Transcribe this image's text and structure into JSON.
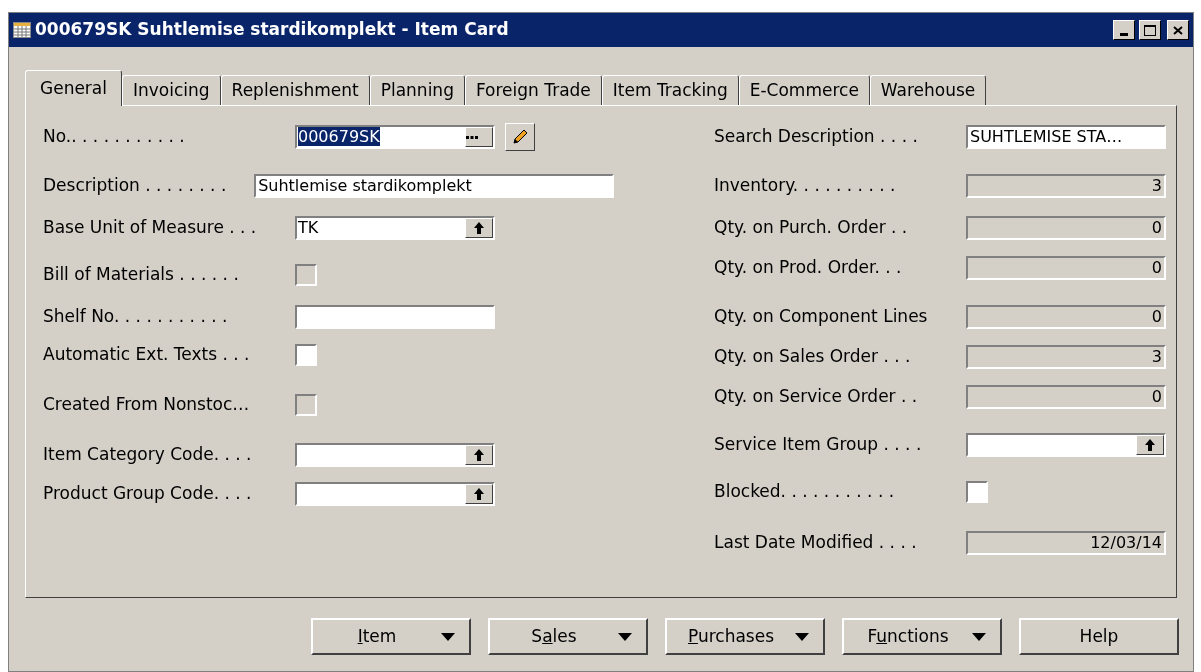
{
  "window": {
    "title": "000679SK Suhtlemise stardikomplekt - Item Card"
  },
  "tabs": [
    {
      "label": "General",
      "selected": true
    },
    {
      "label": "Invoicing",
      "selected": false
    },
    {
      "label": "Replenishment",
      "selected": false
    },
    {
      "label": "Planning",
      "selected": false
    },
    {
      "label": "Foreign Trade",
      "selected": false
    },
    {
      "label": "Item Tracking",
      "selected": false
    },
    {
      "label": "E-Commerce",
      "selected": false
    },
    {
      "label": "Warehouse",
      "selected": false
    }
  ],
  "left_fields": [
    {
      "kind": "code",
      "label": "No.. . . . . . . . . . .",
      "value": "000679SK"
    },
    {
      "kind": "text",
      "label": "Description . . . . . . . .",
      "value": "Suhtlemise stardikomplekt"
    },
    {
      "kind": "lookup",
      "label": "Base Unit of Measure . . .",
      "value": "TK"
    },
    {
      "kind": "checkbox",
      "label": "Bill of Materials . . . . . .",
      "checked": false,
      "disabled": true
    },
    {
      "kind": "input",
      "label": "Shelf No. . . . . . . . . . ."
    },
    {
      "kind": "checkbox",
      "label": "Automatic Ext. Texts . . .",
      "checked": false,
      "disabled": false
    },
    {
      "kind": "checkbox",
      "label": "Created From Nonstoc…",
      "checked": false,
      "disabled": true
    },
    {
      "kind": "lookup",
      "label": "Item Category Code. . . ."
    },
    {
      "kind": "lookup",
      "label": "Product Group Code. . . ."
    }
  ],
  "right_fields": [
    {
      "kind": "input",
      "label": "Search Description . . . .",
      "value": "SUHTLEMISE STA…"
    },
    {
      "kind": "readonly",
      "label": "Inventory. . . . . . . . . .",
      "value": "3"
    },
    {
      "kind": "readonly",
      "label": "Qty. on Purch. Order . .",
      "value": "0"
    },
    {
      "kind": "readonly",
      "label": "Qty. on Prod. Order. . .",
      "value": "0"
    },
    {
      "kind": "readonly",
      "label": "Qty. on Component Lines",
      "value": "0"
    },
    {
      "kind": "readonly",
      "label": "Qty. on Sales Order . . .",
      "value": "3"
    },
    {
      "kind": "readonly",
      "label": "Qty. on Service Order . .",
      "value": "0"
    },
    {
      "kind": "lookup",
      "label": "Service Item Group . . . ."
    },
    {
      "kind": "checkbox",
      "label": "Blocked. . . . . . . . . . .",
      "checked": false,
      "disabled": false
    },
    {
      "kind": "readonly",
      "label": "Last Date Modified . . . .",
      "value": "12/03/14"
    }
  ],
  "buttons": [
    {
      "label_parts": [
        {
          "text": "I",
          "underlined": true
        },
        {
          "text": "tem",
          "underlined": false
        }
      ],
      "menu": true
    },
    {
      "label_parts": [
        {
          "text": "S",
          "underlined": false
        },
        {
          "text": "a",
          "underlined": true
        },
        {
          "text": "les",
          "underlined": false
        }
      ],
      "menu": true
    },
    {
      "label_parts": [
        {
          "text": "P",
          "underlined": true
        },
        {
          "text": "urchases",
          "underlined": false
        }
      ],
      "menu": true
    },
    {
      "label_parts": [
        {
          "text": "F",
          "underlined": false
        },
        {
          "text": "u",
          "underlined": true
        },
        {
          "text": "nctions",
          "underlined": false
        }
      ],
      "menu": true
    },
    {
      "label_parts": [
        {
          "text": "Help",
          "underlined": false
        }
      ],
      "menu": false
    }
  ]
}
